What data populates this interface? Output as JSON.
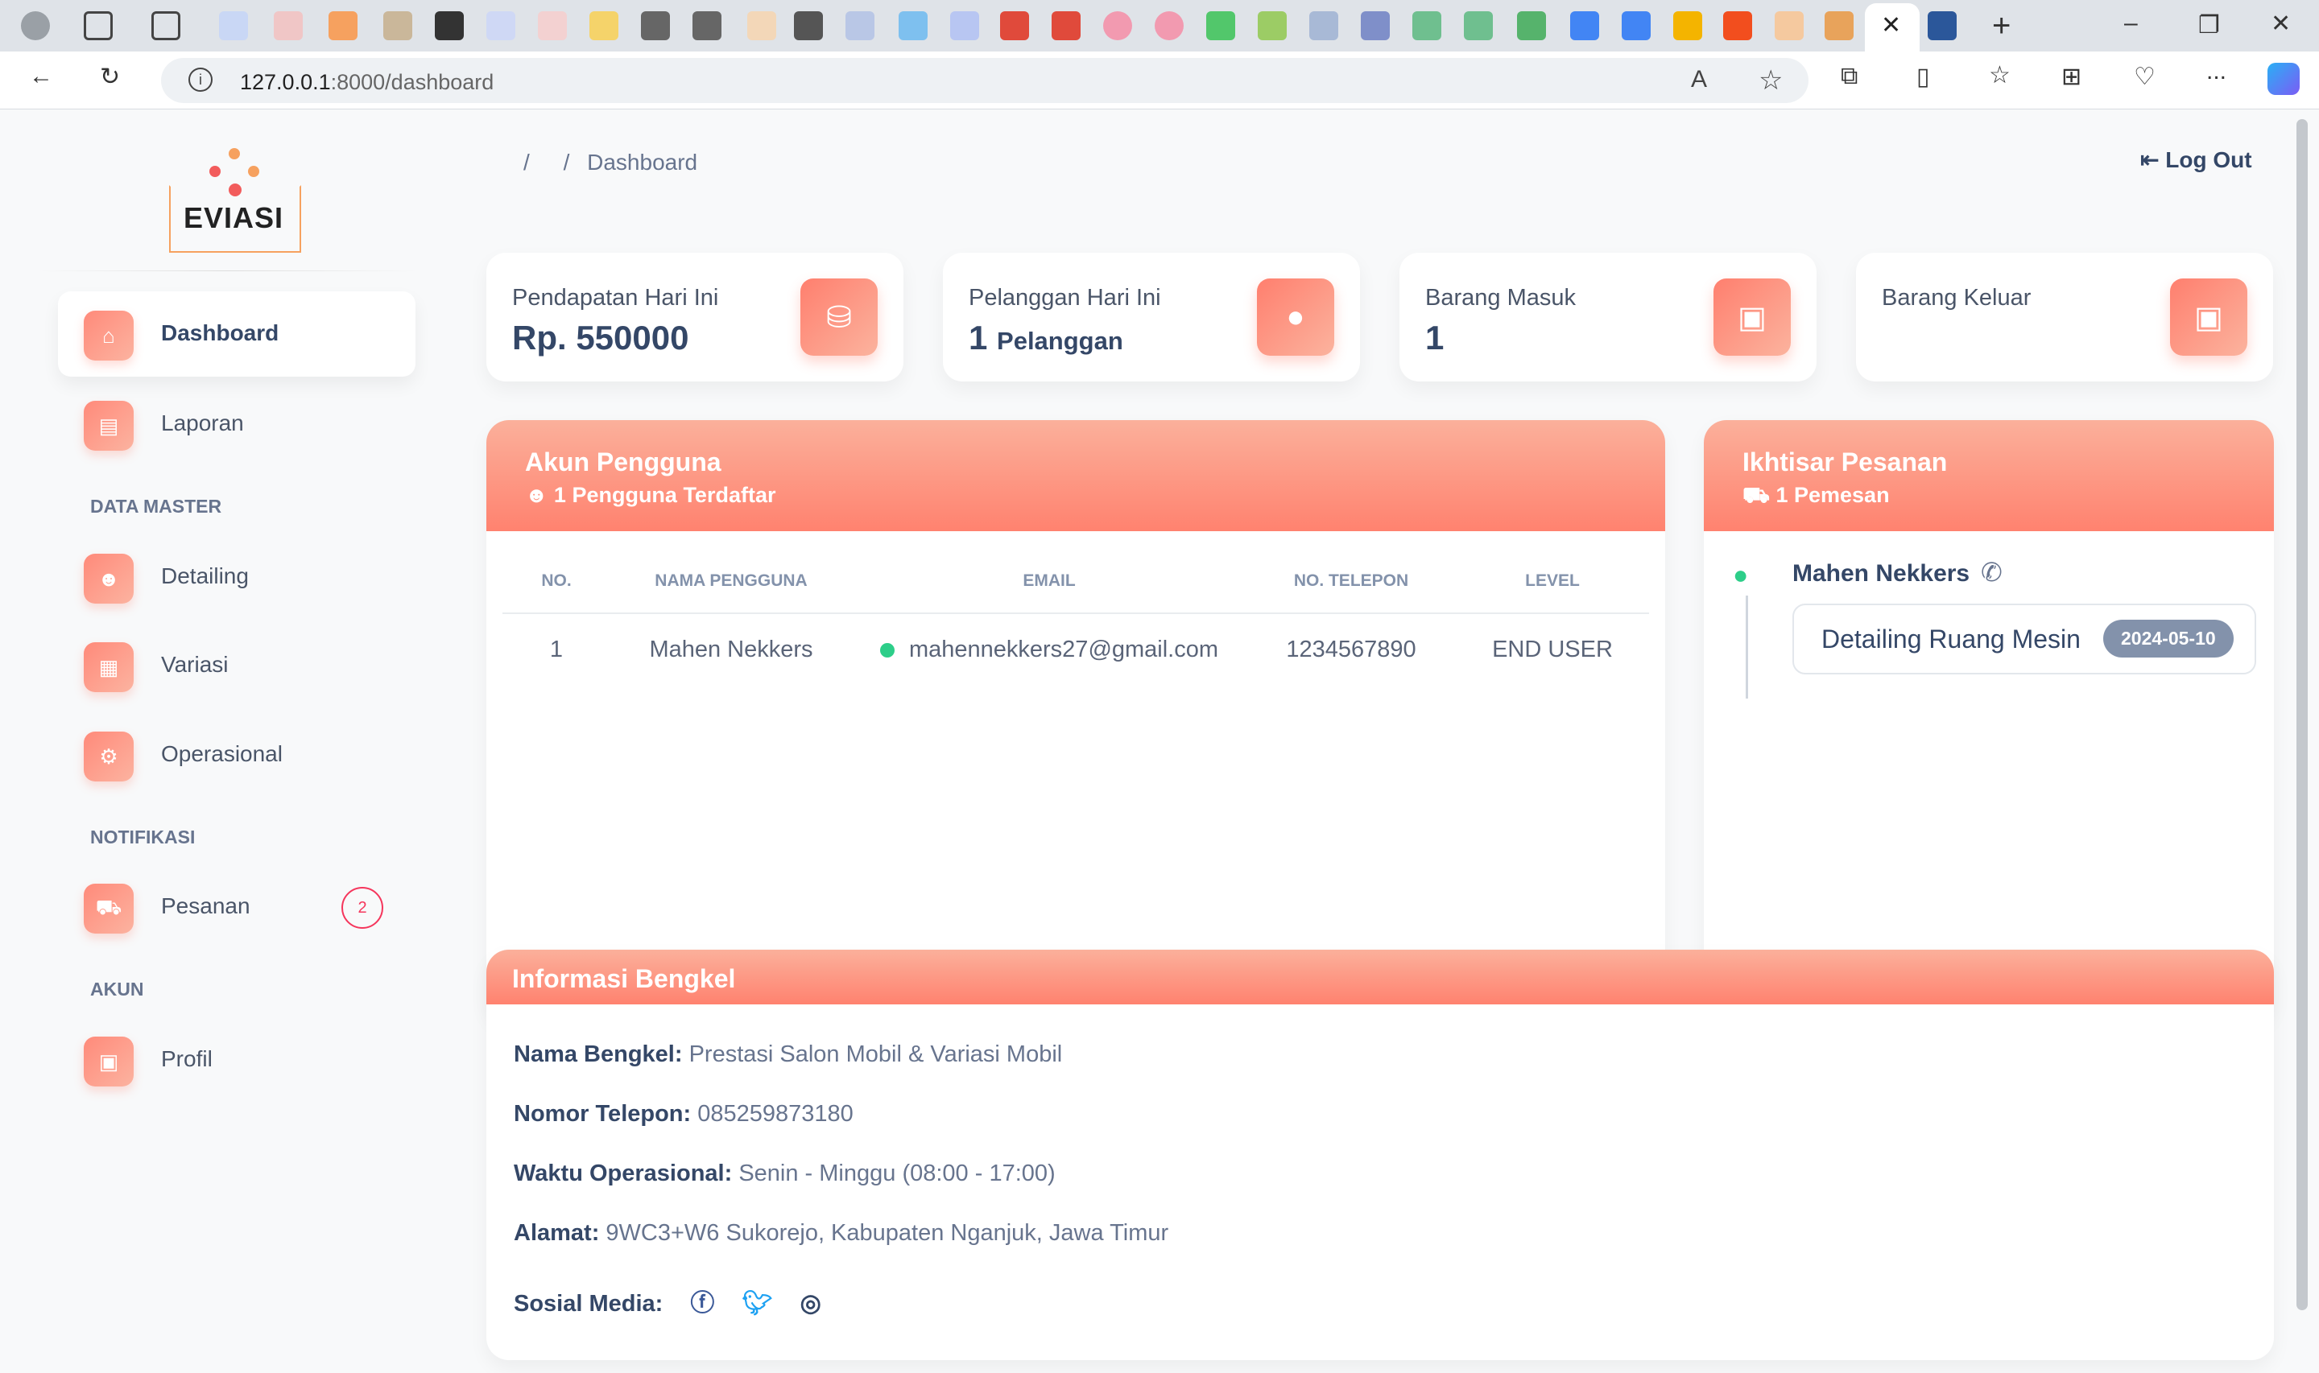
{
  "browser": {
    "url_host": "127.0.0.1",
    "url_path": ":8000/dashboard",
    "back_icon": "arrow-left-icon",
    "reload_icon": "reload-icon",
    "info_icon": "info-icon",
    "more_label": "..."
  },
  "brand": {
    "logo_text": "EVIASI",
    "accent": "#ff826f"
  },
  "sidebar": {
    "items": [
      {
        "label": "Dashboard",
        "icon": "home-icon",
        "active": true
      },
      {
        "label": "Laporan",
        "icon": "excel-icon"
      }
    ],
    "data_master_heading": "DATA MASTER",
    "master_items": [
      {
        "label": "Detailing",
        "icon": "users-icon"
      },
      {
        "label": "Variasi",
        "icon": "building-icon"
      },
      {
        "label": "Operasional",
        "icon": "gear-icon"
      }
    ],
    "notifikasi_heading": "NOTIFIKASI",
    "pesanan": {
      "label": "Pesanan",
      "icon": "cart-icon",
      "count": "2"
    },
    "akun_heading": "AKUN",
    "profil": {
      "label": "Profil",
      "icon": "id-card-icon"
    }
  },
  "header": {
    "breadcrumb_sep1": "/",
    "breadcrumb_sep2": "/",
    "breadcrumb_current": "Dashboard",
    "logout_label": "Log Out"
  },
  "stats": [
    {
      "label": "Pendapatan Hari Ini",
      "value": "Rp. 550000",
      "unit": "",
      "icon": "money-icon"
    },
    {
      "label": "Pelanggan Hari Ini",
      "value": "1",
      "unit": "Pelanggan",
      "icon": "user-icon"
    },
    {
      "label": "Barang Masuk",
      "value": "1",
      "unit": "",
      "icon": "box-open-icon"
    },
    {
      "label": "Barang Keluar",
      "value": "",
      "unit": "",
      "icon": "box-out-icon"
    }
  ],
  "akun": {
    "title": "Akun Pengguna",
    "subtitle": "1 Pengguna Terdaftar",
    "columns": [
      "NO.",
      "NAMA PENGGUNA",
      "EMAIL",
      "NO. TELEPON",
      "LEVEL"
    ],
    "rows": [
      {
        "no": "1",
        "name": "Mahen Nekkers",
        "email": "mahennekkers27@gmail.com",
        "phone": "1234567890",
        "level": "END USER",
        "status_color": "#2dce89"
      }
    ]
  },
  "ikhtisar": {
    "title": "Ikhtisar Pesanan",
    "subtitle": "1 Pemesan",
    "customer": "Mahen Nekkers",
    "order_item": "Detailing Ruang Mesin",
    "order_date": "2024-05-10"
  },
  "bengkel": {
    "title": "Informasi Bengkel",
    "nama_label": "Nama Bengkel:",
    "nama": "Prestasi Salon Mobil & Variasi Mobil",
    "telepon_label": "Nomor Telepon:",
    "telepon": "085259873180",
    "waktu_label": "Waktu Operasional:",
    "waktu": "Senin - Minggu (08:00 - 17:00)",
    "alamat_label": "Alamat:",
    "alamat": "9WC3+W6 Sukorejo, Kabupaten Nganjuk, Jawa Timur",
    "sosial_label": "Sosial Media:",
    "facebook_color": "#3b5998",
    "twitter_color": "#1da1f2",
    "instagram_color": "#344767"
  }
}
